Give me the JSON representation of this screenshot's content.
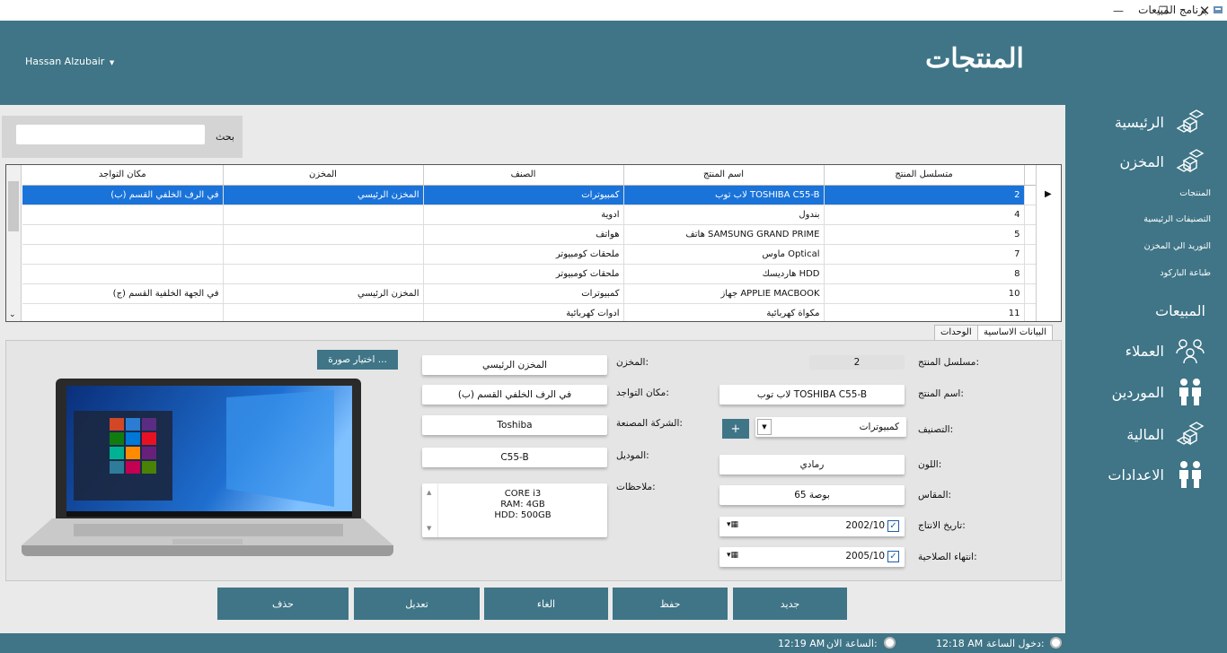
{
  "window": {
    "title": "برنامج المبيعات"
  },
  "header": {
    "user": "Hassan Alzubair",
    "page_title": "المنتجات"
  },
  "sidebar": {
    "items": [
      {
        "label": "الرئيسية",
        "icon": "boxes-icon"
      },
      {
        "label": "المخزن",
        "icon": "boxes-icon"
      },
      {
        "label": "المبيعات",
        "icon": ""
      },
      {
        "label": "العملاء",
        "icon": "users-icon"
      },
      {
        "label": "الموردين",
        "icon": "people-icon"
      },
      {
        "label": "المالية",
        "icon": "boxes-icon"
      },
      {
        "label": "الاعدادات",
        "icon": "people-icon"
      }
    ],
    "subitems": [
      "المنتجات",
      "التصنيفات الرئيسية",
      "التوريد الي المخزن",
      "طباعة الباركود"
    ]
  },
  "search": {
    "label": "بحث",
    "value": ""
  },
  "grid": {
    "columns": [
      "متسلسل المنتج",
      "اسم المنتج",
      "الصنف",
      "المخزن",
      "مكان التواجد"
    ],
    "rows": [
      [
        "2",
        "لاب توب TOSHIBA C55-B",
        "كمبيوترات",
        "المخزن الرئيسي",
        "في الرف الخلفي القسم (ب)"
      ],
      [
        "4",
        "بندول",
        "ادوية",
        "",
        ""
      ],
      [
        "5",
        "هاتف SAMSUNG GRAND PRIME",
        "هواتف",
        "",
        ""
      ],
      [
        "7",
        "ماوس Optical",
        "ملحقات  كومبيوتر",
        "",
        ""
      ],
      [
        "8",
        "هارديسك HDD",
        "ملحقات  كومبيوتر",
        "",
        ""
      ],
      [
        "10",
        "جهاز APPLIE MACBOOK",
        "كمبيوترات",
        "المخزن الرئيسي",
        "في الجهة الخلفية القسم (ج)"
      ],
      [
        "11",
        "مكواة كهربائية",
        "ادوات كهربائية",
        "",
        ""
      ]
    ]
  },
  "tabs": [
    "البيانات الاساسية",
    "الوحدات"
  ],
  "form": {
    "serial_label": "مسلسل المنتج:",
    "serial": "2",
    "name_label": "اسم المنتج:",
    "name": "لاب توب TOSHIBA C55-B",
    "category_label": "التصنيف:",
    "category": "كمبيوترات",
    "color_label": "اللون:",
    "color": "رمادي",
    "size_label": "المقاس:",
    "size": "65 بوصة",
    "production_label": "تاريخ الانتاج:",
    "production": "2002/10",
    "expiry_label": "انتهاء الصلاحية:",
    "expiry": "2005/10",
    "store_label": "المخزن:",
    "store": "المخزن الرئيسي",
    "location_label": "مكان التواجد:",
    "location": "في الرف الخلفي القسم (ب)",
    "maker_label": "الشركة المصنعة:",
    "maker": "Toshiba",
    "model_label": "الموديل:",
    "model": "C55-B",
    "notes_label": "ملاحظات:",
    "notes": [
      "CORE i3",
      "RAM: 4GB",
      "HDD: 500GB"
    ],
    "choose_image": "اختيار صورة ...",
    "add_category": "+"
  },
  "actions": {
    "new": "جديد",
    "save": "حفظ",
    "cancel": "الغاء",
    "edit": "تعديل",
    "delete": "حذف"
  },
  "status": {
    "login_label": "دخول الساعة:",
    "login_time": "12:18 AM",
    "now_label": "الساعة الان:",
    "now_time": "12:19 AM"
  },
  "colors": {
    "primary": "#3f7587",
    "selection": "#1a73d9"
  }
}
